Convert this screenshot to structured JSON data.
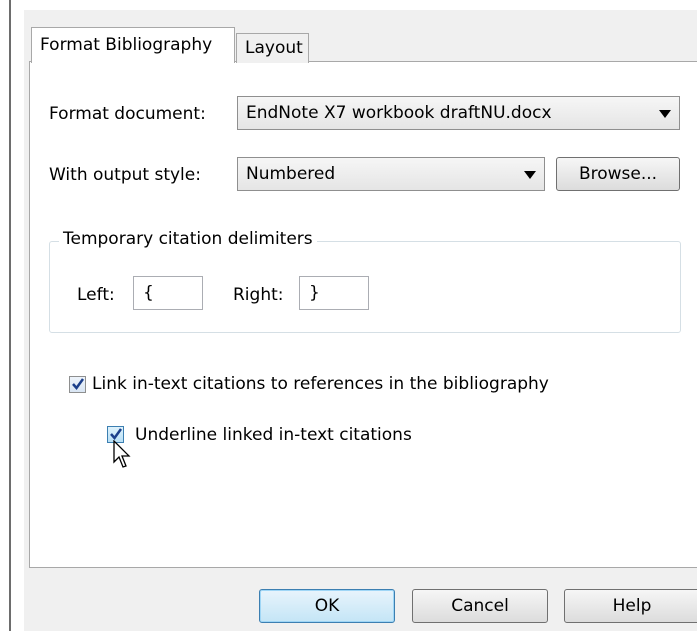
{
  "tabs": [
    {
      "label": "Format Bibliography",
      "active": true
    },
    {
      "label": "Layout",
      "active": false
    }
  ],
  "format_document": {
    "label": "Format document:",
    "value": "EndNote X7 workbook draftNU.docx"
  },
  "output_style": {
    "label": "With output style:",
    "value": "Numbered",
    "browse_label": "Browse..."
  },
  "delimiters": {
    "title": "Temporary citation delimiters",
    "left_label": "Left:",
    "left_value": "{",
    "right_label": "Right:",
    "right_value": "}"
  },
  "options": {
    "link_label": "Link in-text citations to references in the bibliography",
    "link_checked": true,
    "underline_label": "Underline linked in-text citations",
    "underline_checked": true
  },
  "buttons": {
    "ok": "OK",
    "cancel": "Cancel",
    "help": "Help"
  },
  "colors": {
    "checkmark": "#1b3f8b",
    "default_button_border": "#3c7fb1"
  }
}
